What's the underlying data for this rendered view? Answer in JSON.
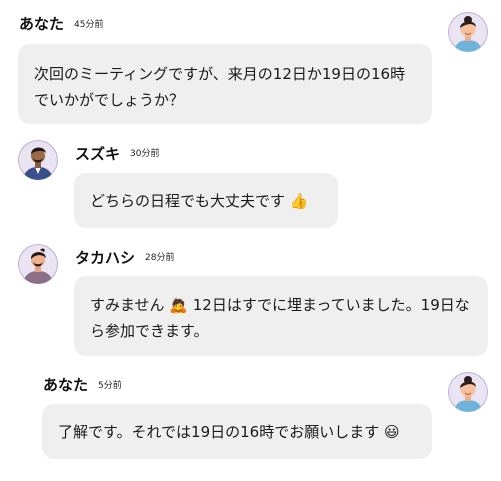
{
  "messages": [
    {
      "sender": "あなた",
      "time": "45分前",
      "text": "次回のミーティングですが、来月の12日か19日の16時でいかがでしょうか？",
      "avatar_icon": "woman-avatar-icon"
    },
    {
      "sender": "スズキ",
      "time": "30分前",
      "text": "どちらの日程でも大丈夫です 👍",
      "avatar_icon": "man-avatar-icon"
    },
    {
      "sender": "タカハシ",
      "time": "28分前",
      "text": "すみません 🙇 12日はすでに埋まっていました。19日なら参加できます。",
      "avatar_icon": "man-avatar-icon"
    },
    {
      "sender": "あなた",
      "time": "5分前",
      "text": "了解です。それでは19日の16時でお願いします 😃",
      "avatar_icon": "woman-avatar-icon"
    }
  ],
  "colors": {
    "bubble": "#efefef",
    "avatar_background": "#e6e0f0",
    "avatar_ring": "#b8a9d6"
  }
}
